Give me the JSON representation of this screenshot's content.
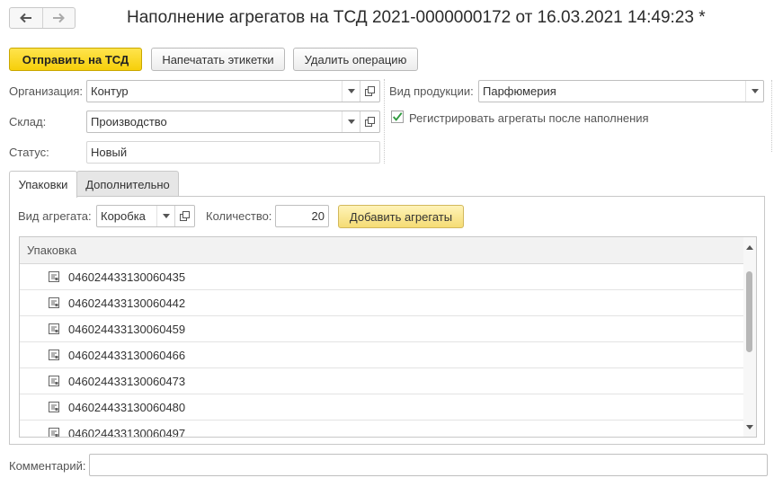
{
  "header": {
    "title": "Наполнение агрегатов на ТСД 2021-0000000172 от 16.03.2021 14:49:23 *",
    "back_icon": "arrow-left-icon",
    "forward_icon": "arrow-right-icon"
  },
  "toolbar": {
    "send_label": "Отправить на ТСД",
    "print_label": "Напечатать этикетки",
    "delete_label": "Удалить операцию"
  },
  "form": {
    "organization_label": "Организация:",
    "organization_value": "Контур",
    "warehouse_label": "Склад:",
    "warehouse_value": "Производство",
    "status_label": "Статус:",
    "status_value": "Новый",
    "product_type_label": "Вид продукции:",
    "product_type_value": "Парфюмерия",
    "register_checkbox_label": "Регистрировать агрегаты после наполнения",
    "register_checked": true
  },
  "tabs": [
    {
      "label": "Упаковки",
      "active": true
    },
    {
      "label": "Дополнительно",
      "active": false
    }
  ],
  "packages_tab": {
    "aggregate_type_label": "Вид агрегата:",
    "aggregate_type_value": "Коробка",
    "quantity_label": "Количество:",
    "quantity_value": "20",
    "add_button_label": "Добавить агрегаты"
  },
  "table": {
    "column_header": "Упаковка",
    "rows": [
      "046024433130060435",
      "046024433130060442",
      "046024433130060459",
      "046024433130060466",
      "046024433130060473",
      "046024433130060480",
      "046024433130060497"
    ]
  },
  "footer": {
    "comment_label": "Комментарий:",
    "comment_value": ""
  },
  "colors": {
    "primary_button": "#f6cf0a",
    "checkbox_check": "#2f9a3e"
  }
}
